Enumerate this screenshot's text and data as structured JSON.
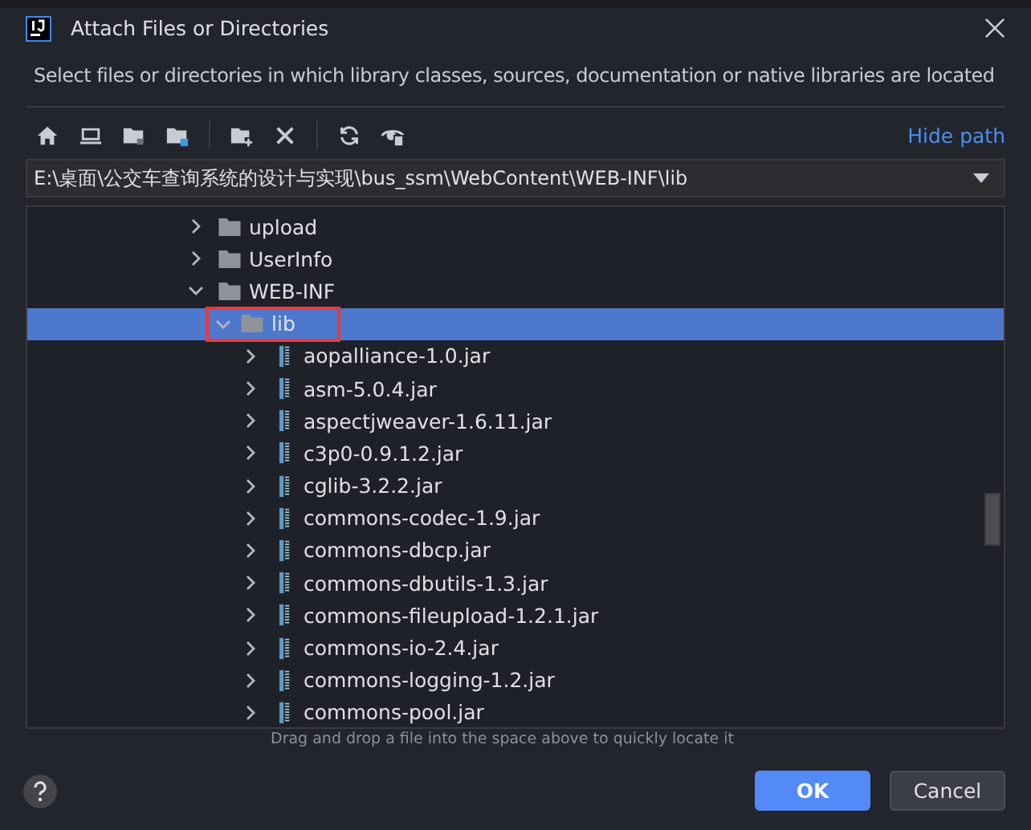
{
  "window": {
    "title": "Attach Files or Directories"
  },
  "description": "Select files or directories in which library classes, sources, documentation or native libraries are located",
  "toolbar": {
    "buttons": [
      {
        "kind": "home"
      },
      {
        "kind": "desktop"
      },
      {
        "kind": "project"
      },
      {
        "kind": "module"
      },
      {
        "kind": "sep"
      },
      {
        "kind": "new-folder"
      },
      {
        "kind": "delete"
      },
      {
        "kind": "sep"
      },
      {
        "kind": "refresh"
      },
      {
        "kind": "hidden"
      }
    ],
    "hide_path_link": "Hide path"
  },
  "path": {
    "value": "E:\\桌面\\公交车查询系统的设计与实现\\bus_ssm\\WebContent\\WEB-INF\\lib"
  },
  "tree": {
    "items": [
      {
        "kind": "folder",
        "label": "upload",
        "expanded": false,
        "selected": false
      },
      {
        "kind": "folder",
        "label": "UserInfo",
        "expanded": false,
        "selected": false
      },
      {
        "kind": "folder",
        "label": "WEB-INF",
        "expanded": true,
        "selected": false,
        "children": [
          {
            "kind": "folder",
            "label": "lib",
            "expanded": true,
            "selected": true,
            "highlighted": true,
            "children": [
              {
                "kind": "jar",
                "label": "aopalliance-1.0.jar",
                "expanded": false,
                "selected": false
              },
              {
                "kind": "jar",
                "label": "asm-5.0.4.jar",
                "expanded": false,
                "selected": false
              },
              {
                "kind": "jar",
                "label": "aspectjweaver-1.6.11.jar",
                "expanded": false,
                "selected": false
              },
              {
                "kind": "jar",
                "label": "c3p0-0.9.1.2.jar",
                "expanded": false,
                "selected": false
              },
              {
                "kind": "jar",
                "label": "cglib-3.2.2.jar",
                "expanded": false,
                "selected": false
              },
              {
                "kind": "jar",
                "label": "commons-codec-1.9.jar",
                "expanded": false,
                "selected": false
              },
              {
                "kind": "jar",
                "label": "commons-dbcp.jar",
                "expanded": false,
                "selected": false
              },
              {
                "kind": "jar",
                "label": "commons-dbutils-1.3.jar",
                "expanded": false,
                "selected": false
              },
              {
                "kind": "jar",
                "label": "commons-fileupload-1.2.1.jar",
                "expanded": false,
                "selected": false
              },
              {
                "kind": "jar",
                "label": "commons-io-2.4.jar",
                "expanded": false,
                "selected": false
              },
              {
                "kind": "jar",
                "label": "commons-logging-1.2.jar",
                "expanded": false,
                "selected": false
              },
              {
                "kind": "jar",
                "label": "commons-pool.jar",
                "expanded": false,
                "selected": false
              }
            ]
          }
        ]
      }
    ]
  },
  "hint": "Drag and drop a file into the space above to quickly locate it",
  "buttons": [
    {
      "label": "OK",
      "kind": "primary"
    },
    {
      "label": "Cancel",
      "kind": "secondary"
    }
  ]
}
